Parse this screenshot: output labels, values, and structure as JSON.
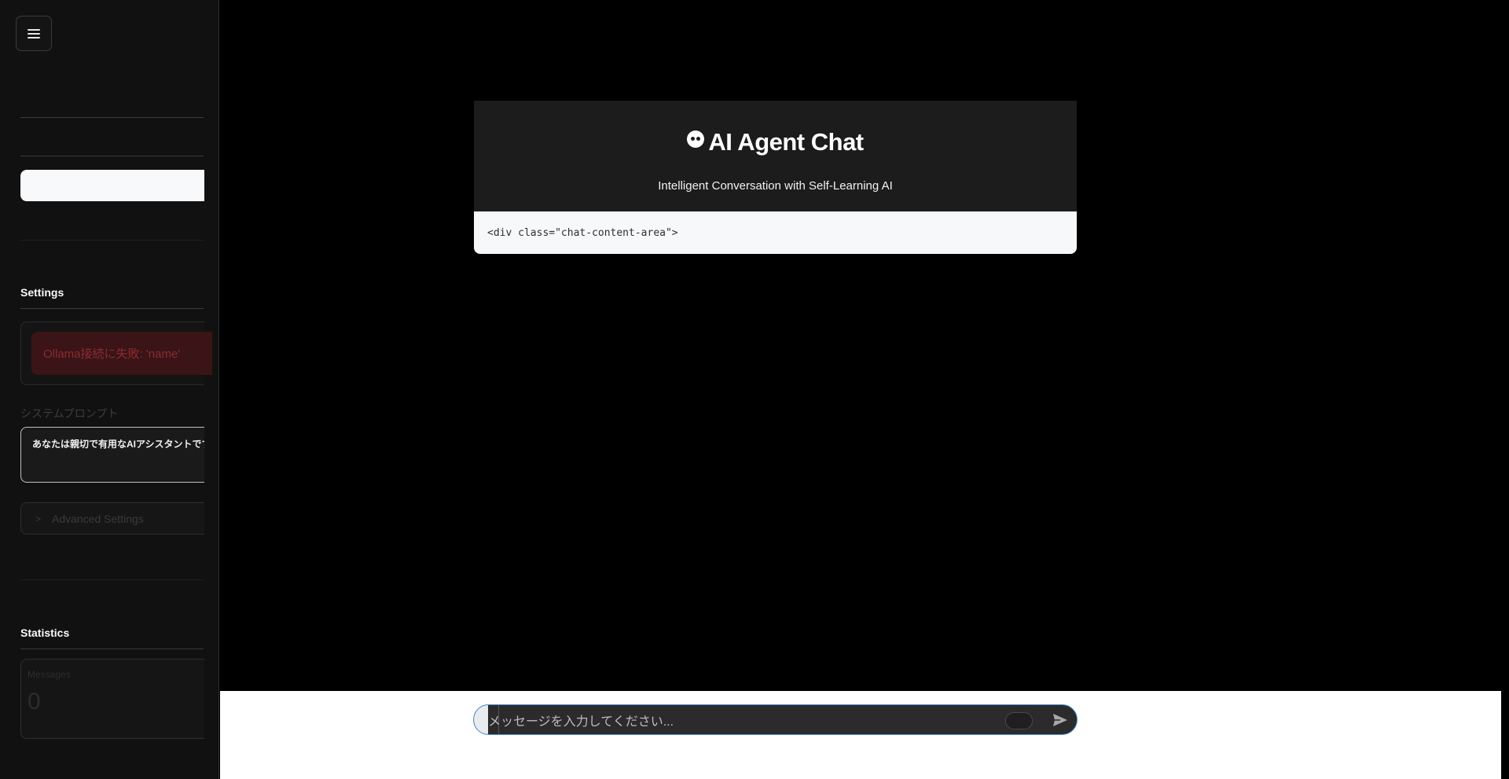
{
  "sidebar": {
    "settings_title": "Settings",
    "ollama_error": "Ollama接続に失敗: 'name'",
    "system_prompt_label": "システムプロンプト",
    "system_prompt_value": "あなたは親切で有用なAIアシスタントです",
    "advanced_settings_label": "Advanced Settings",
    "statistics_title": "Statistics",
    "stats": {
      "messages_label": "Messages",
      "messages_value": "0"
    }
  },
  "main": {
    "title": "AI Agent Chat",
    "subtitle": "Intelligent Conversation with Self-Learning AI",
    "code_snippet": "<div class=\"chat-content-area\">"
  },
  "chat_input": {
    "placeholder": "メッセージを入力してください..."
  },
  "icons": {
    "menu": "hamburger-menu-icon",
    "title": "robot-face-icon",
    "advanced": "chevron-right-icon",
    "send": "send-arrow-icon"
  },
  "colors": {
    "main_background": "#000000",
    "sidebar_background": "#111111",
    "header_card": "#1c1c1c",
    "error_background": "#3a1416",
    "error_text": "#8a2c30",
    "input_focus_border": "#4a90d9"
  }
}
